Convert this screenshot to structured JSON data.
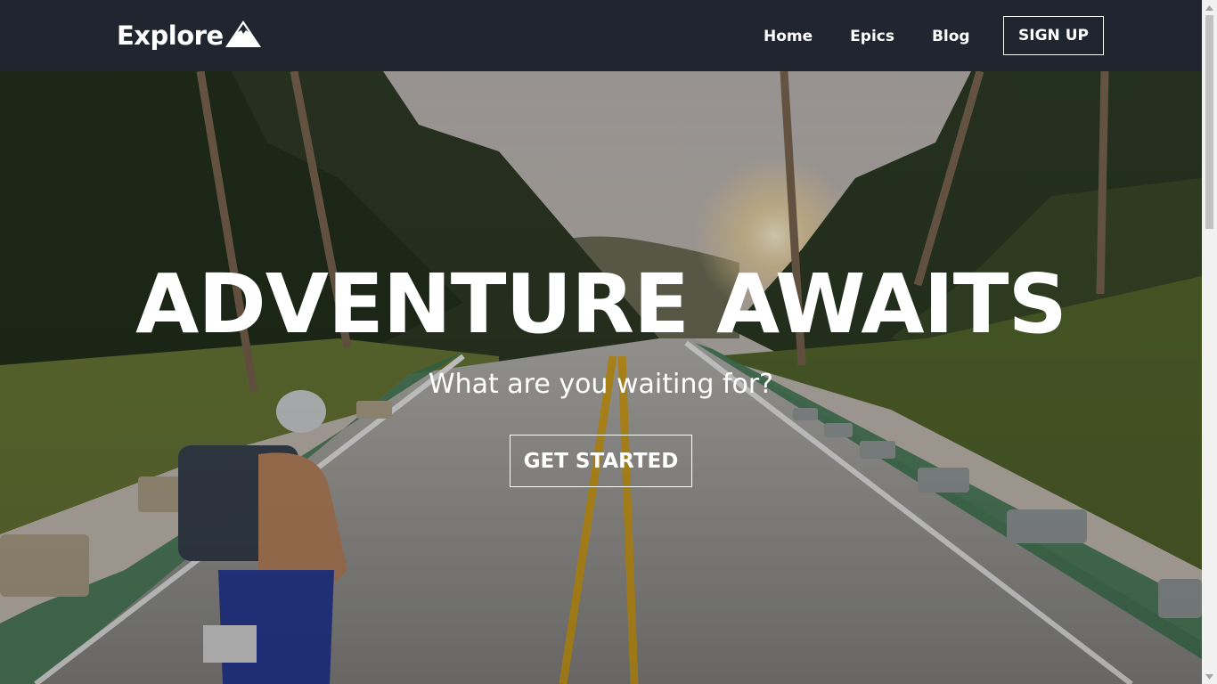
{
  "brand": {
    "name": "Explore",
    "icon": "mountain-icon"
  },
  "nav": {
    "links": [
      {
        "label": "Home"
      },
      {
        "label": "Epics"
      },
      {
        "label": "Blog"
      }
    ],
    "signup_label": "SIGN UP"
  },
  "hero": {
    "title": "ADVENTURE AWAITS",
    "subtitle": "What are you waiting for?",
    "cta_label": "GET STARTED",
    "background": "tropical-road-scooter-photo"
  },
  "colors": {
    "navbar": "#20252f",
    "text": "#ffffff"
  }
}
